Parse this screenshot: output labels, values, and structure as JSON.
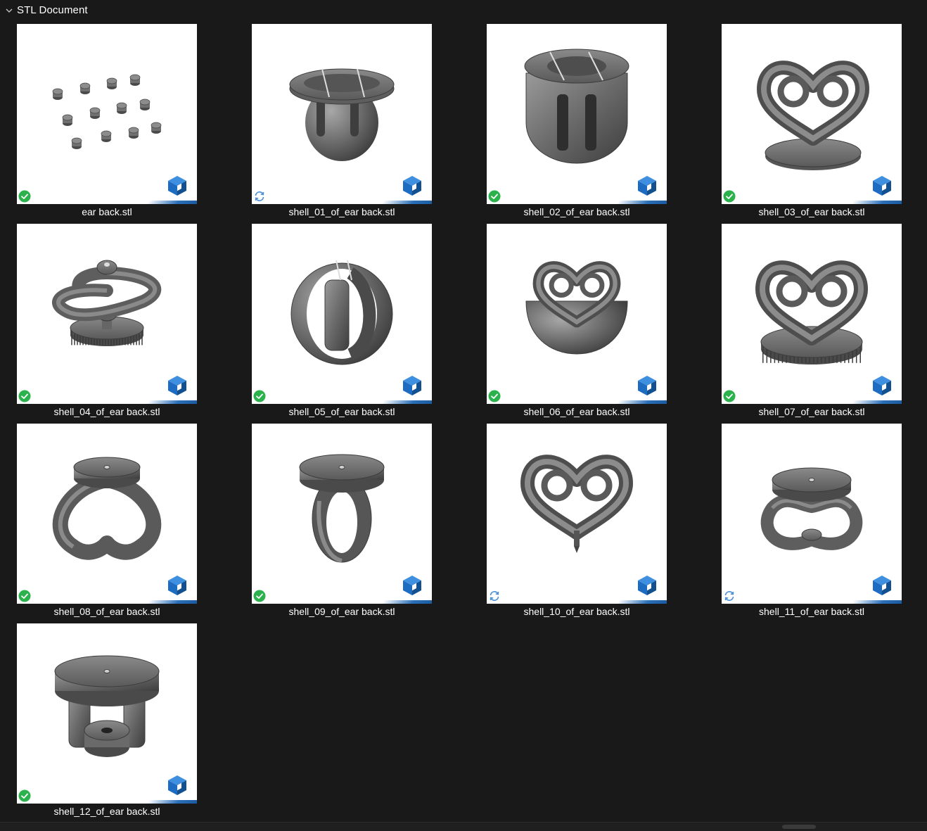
{
  "group": {
    "title": "STL Document",
    "chevron_icon": "chevron-down-icon"
  },
  "files": [
    {
      "name": "ear back.stl",
      "status": "synced",
      "model": "assembly-scatter"
    },
    {
      "name": "shell_01_of_ear back.stl",
      "status": "syncing",
      "model": "dome-ring-cap"
    },
    {
      "name": "shell_02_of_ear back.stl",
      "status": "synced",
      "model": "cup-bucket"
    },
    {
      "name": "shell_03_of_ear back.stl",
      "status": "synced",
      "model": "heart-on-disc"
    },
    {
      "name": "shell_04_of_ear back.stl",
      "status": "synced",
      "model": "loop-on-gear"
    },
    {
      "name": "shell_05_of_ear back.stl",
      "status": "synced",
      "model": "slotted-sphere"
    },
    {
      "name": "shell_06_of_ear back.stl",
      "status": "synced",
      "model": "heart-in-bowl"
    },
    {
      "name": "shell_07_of_ear back.stl",
      "status": "synced",
      "model": "heart-on-gear"
    },
    {
      "name": "shell_08_of_ear back.stl",
      "status": "synced",
      "model": "spade-under-cap"
    },
    {
      "name": "shell_09_of_ear back.stl",
      "status": "synced",
      "model": "loop-under-cap"
    },
    {
      "name": "shell_10_of_ear back.stl",
      "status": "syncing",
      "model": "heart-with-pin"
    },
    {
      "name": "shell_11_of_ear back.stl",
      "status": "syncing",
      "model": "heart-loop-under-cap"
    },
    {
      "name": "shell_12_of_ear back.stl",
      "status": "synced",
      "model": "ring-under-cap"
    }
  ],
  "icons": {
    "synced": "check-circle-icon",
    "syncing": "sync-arrows-icon",
    "brand": "cube-logo-icon"
  },
  "colors": {
    "background": "#191919",
    "thumbnail_bg": "#ffffff",
    "model_gray": "#6e6e6e",
    "synced_green": "#2bb24c",
    "syncing_blue": "#4a90d9",
    "brand_blue": "#1d6cc2"
  }
}
